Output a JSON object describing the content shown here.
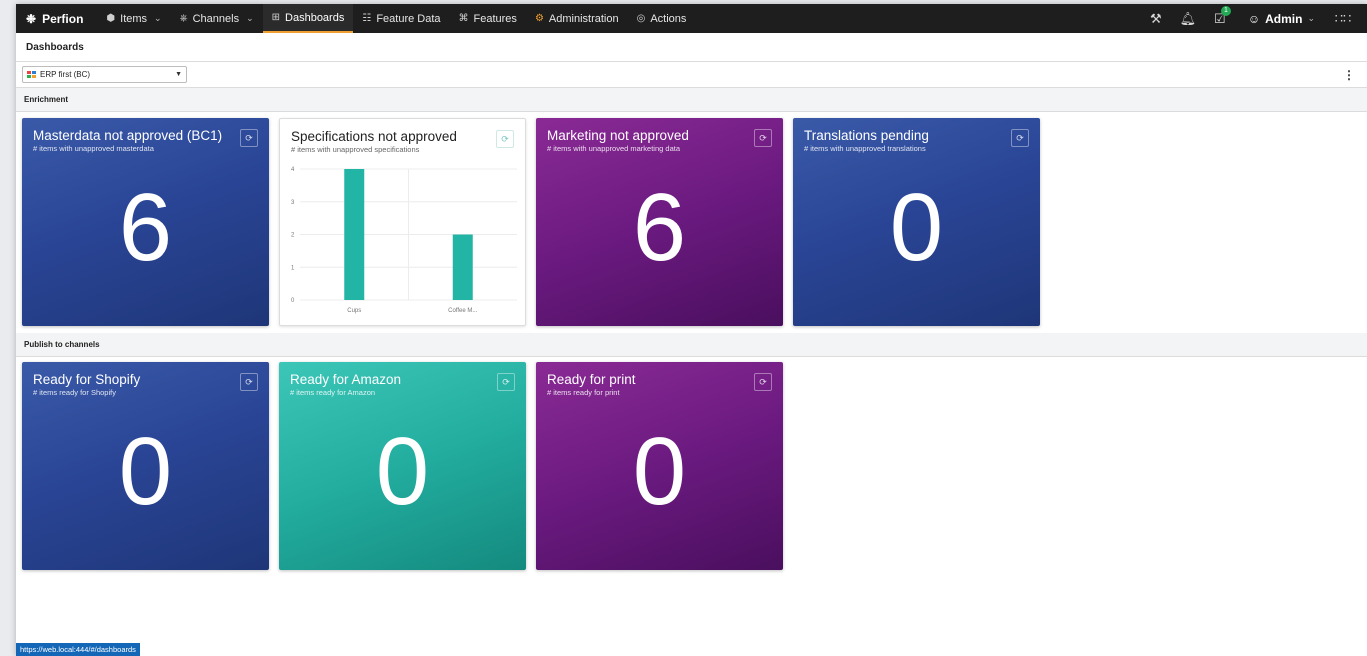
{
  "nav": {
    "brand": "Perfion",
    "items": [
      {
        "label": "Items",
        "icon": "cube-icon",
        "dropdown": true
      },
      {
        "label": "Channels",
        "icon": "channels-icon",
        "dropdown": true
      },
      {
        "label": "Dashboards",
        "icon": "dashboard-icon",
        "dropdown": false,
        "active": true
      },
      {
        "label": "Feature Data",
        "icon": "feature-data-icon",
        "dropdown": false
      },
      {
        "label": "Features",
        "icon": "features-icon",
        "dropdown": false
      },
      {
        "label": "Administration",
        "icon": "gear-icon",
        "dropdown": false
      },
      {
        "label": "Actions",
        "icon": "actions-icon",
        "dropdown": false
      }
    ],
    "tasks_badge": "1",
    "user": "Admin"
  },
  "page_title": "Dashboards",
  "toolbar": {
    "dashboard_selected": "ERP first (BC)"
  },
  "sections": {
    "enrichment": "Enrichment",
    "publish": "Publish to channels"
  },
  "tiles": {
    "masterdata": {
      "title": "Masterdata not approved (BC1)",
      "subtitle": "# items with unapproved masterdata",
      "value": "6"
    },
    "specs": {
      "title": "Specifications not approved",
      "subtitle": "# items with unapproved specifications"
    },
    "marketing": {
      "title": "Marketing not approved",
      "subtitle": "# items with unapproved marketing data",
      "value": "6"
    },
    "translations": {
      "title": "Translations pending",
      "subtitle": "# items with unapproved translations",
      "value": "0"
    },
    "shopify": {
      "title": "Ready for Shopify",
      "subtitle": "# items ready for Shopify",
      "value": "0"
    },
    "amazon": {
      "title": "Ready for Amazon",
      "subtitle": "# items ready for Amazon",
      "value": "0"
    },
    "print": {
      "title": "Ready for print",
      "subtitle": "# items ready for print",
      "value": "0"
    }
  },
  "chart_data": {
    "type": "bar",
    "categories": [
      "Cups",
      "Coffee M..."
    ],
    "values": [
      4,
      2
    ],
    "ylim": [
      0,
      4
    ],
    "yticks": [
      "0",
      "1",
      "2",
      "3",
      "4"
    ],
    "bar_color": "#22b5a6",
    "grid": true
  },
  "status_url": "https://web.local:444/#/dashboards",
  "colors": {
    "nav_bg": "#1e1e1e",
    "active_underline": "#f0a030",
    "tile_blue": "#2a4596",
    "tile_purple": "#6b1a80",
    "tile_teal": "#22ad9f"
  }
}
